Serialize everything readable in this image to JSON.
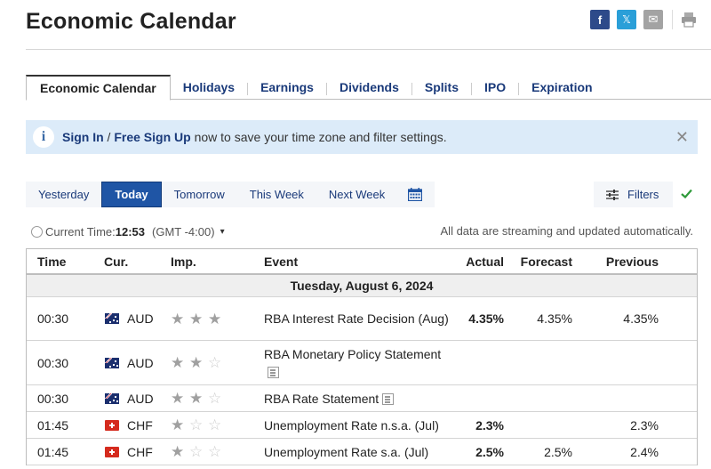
{
  "page": {
    "title": "Economic Calendar"
  },
  "share": {
    "facebook_glyph": "f",
    "x_glyph": "𝕏",
    "email_glyph": "✉",
    "icons": [
      "facebook-icon",
      "x-icon",
      "email-icon",
      "print-icon"
    ]
  },
  "tabs": [
    {
      "label": "Economic Calendar",
      "active": true
    },
    {
      "label": "Holidays"
    },
    {
      "label": "Earnings"
    },
    {
      "label": "Dividends"
    },
    {
      "label": "Splits"
    },
    {
      "label": "IPO"
    },
    {
      "label": "Expiration"
    }
  ],
  "banner": {
    "info_glyph": "i",
    "sign_in": "Sign In",
    "slash": " / ",
    "sign_up": "Free Sign Up",
    "message": " now to save your time zone and filter settings.",
    "close_glyph": "✕"
  },
  "datebar": {
    "buttons": [
      {
        "label": "Yesterday"
      },
      {
        "label": "Today",
        "active": true
      },
      {
        "label": "Tomorrow"
      },
      {
        "label": "This Week"
      },
      {
        "label": "Next Week"
      }
    ]
  },
  "filters": {
    "label": "Filters",
    "applied_color": "#2e9a3a"
  },
  "current_time": {
    "label": "Current Time:",
    "time": "12:53",
    "timezone": "(GMT -4:00)",
    "caret": "⌄"
  },
  "streaming_note": "All data are streaming and updated automatically.",
  "table": {
    "headers": {
      "time": "Time",
      "cur": "Cur.",
      "imp": "Imp.",
      "event": "Event",
      "actual": "Actual",
      "forecast": "Forecast",
      "previous": "Previous"
    },
    "date_label": "Tuesday, August 6, 2024",
    "rows": [
      {
        "time": "00:30",
        "flag": "au",
        "currency": "AUD",
        "importance": 3,
        "event": "RBA Interest Rate Decision (Aug)",
        "doc": false,
        "actual": "4.35%",
        "forecast": "4.35%",
        "previous": "4.35%"
      },
      {
        "time": "00:30",
        "flag": "au",
        "currency": "AUD",
        "importance": 2,
        "event": "RBA Monetary Policy Statement",
        "doc": true,
        "actual": "",
        "forecast": "",
        "previous": ""
      },
      {
        "time": "00:30",
        "flag": "au",
        "currency": "AUD",
        "importance": 2,
        "event": "RBA Rate Statement",
        "doc": true,
        "actual": "",
        "forecast": "",
        "previous": ""
      },
      {
        "time": "01:45",
        "flag": "ch",
        "currency": "CHF",
        "importance": 1,
        "event": "Unemployment Rate n.s.a. (Jul)",
        "doc": false,
        "actual": "2.3%",
        "forecast": "",
        "previous": "2.3%"
      },
      {
        "time": "01:45",
        "flag": "ch",
        "currency": "CHF",
        "importance": 1,
        "event": "Unemployment Rate s.a. (Jul)",
        "doc": false,
        "actual": "2.5%",
        "forecast": "2.5%",
        "previous": "2.4%"
      }
    ]
  }
}
